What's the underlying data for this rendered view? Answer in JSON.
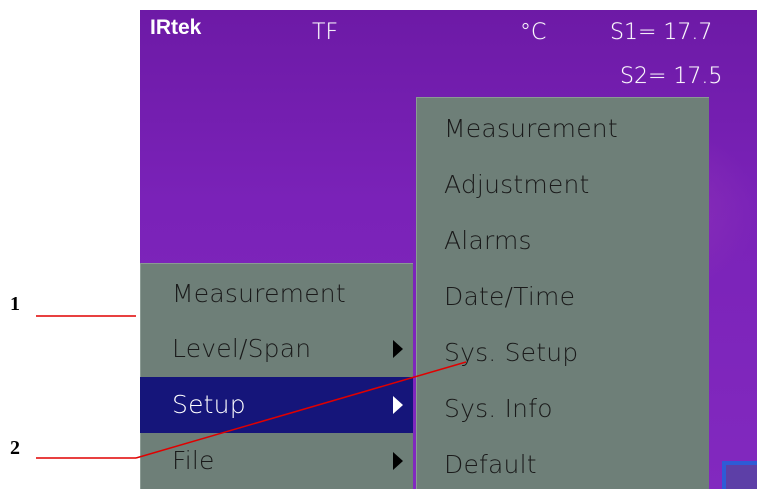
{
  "header": {
    "logo": "IRtek",
    "mode": "TF",
    "unit": "°C",
    "s1": "S1= 17.7",
    "s2": "S2= 17.5"
  },
  "left_menu": {
    "items": [
      {
        "label": "Measurement",
        "has_submenu": false,
        "selected": false
      },
      {
        "label": "Level/Span",
        "has_submenu": true,
        "selected": false
      },
      {
        "label": "Setup",
        "has_submenu": true,
        "selected": true
      },
      {
        "label": "File",
        "has_submenu": true,
        "selected": false
      }
    ]
  },
  "right_menu": {
    "items": [
      {
        "label": "Measurement"
      },
      {
        "label": "Adjustment"
      },
      {
        "label": "Alarms"
      },
      {
        "label": "Date/Time"
      },
      {
        "label": "Sys. Setup"
      },
      {
        "label": "Sys. Info"
      },
      {
        "label": "Default"
      }
    ]
  },
  "callouts": [
    "1",
    "2"
  ],
  "colors": {
    "background": "#7a22b8",
    "menu": "#6e7f78",
    "selection": "#15157a",
    "callout_line": "#e00000"
  }
}
